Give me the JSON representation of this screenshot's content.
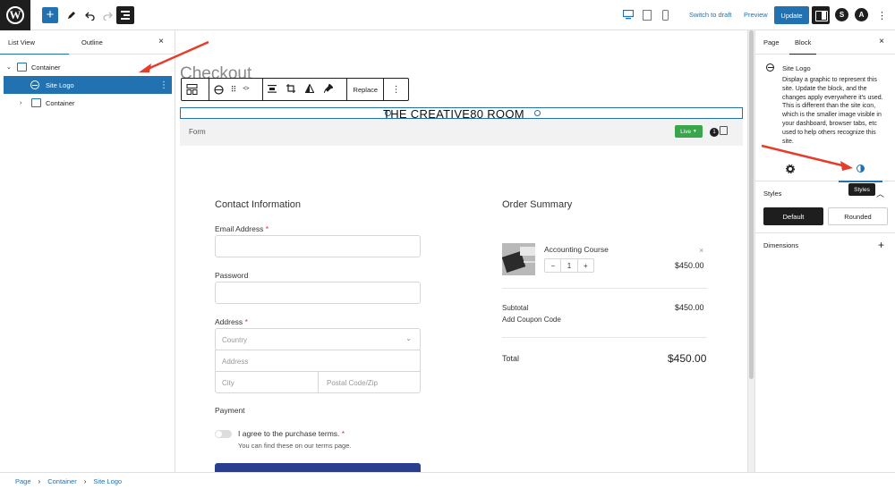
{
  "topbar": {
    "add_label": "+",
    "switch_to_draft": "Switch to draft",
    "preview": "Preview",
    "update": "Update",
    "plugin_a": "S",
    "plugin_b": "A"
  },
  "list_view": {
    "tabs": [
      "List View",
      "Outline"
    ],
    "close": "×",
    "items": [
      {
        "label": "Container"
      },
      {
        "label": "Site Logo"
      },
      {
        "label": "Container"
      }
    ],
    "more": "⋮"
  },
  "canvas": {
    "page_title": "Checkout",
    "toolbar_replace": "Replace",
    "site_logo_text": "THE CREATIVE80 ROOM",
    "form_label": "Form",
    "live_badge": "Live",
    "cart_count": "1",
    "contact": {
      "title": "Contact Information",
      "email_label": "Email Address",
      "password_label": "Password",
      "address_label": "Address",
      "required_mark": "*",
      "country_placeholder": "Country",
      "address_placeholder": "Address",
      "city_placeholder": "City",
      "postal_placeholder": "Postal Code/Zip",
      "payment_label": "Payment",
      "terms_label": "I agree to the purchase terms.",
      "terms_note": "You can find these on our terms page."
    },
    "order": {
      "title": "Order Summary",
      "item_name": "Accounting Course",
      "item_price": "$450.00",
      "qty_minus": "−",
      "qty_value": "1",
      "qty_plus": "+",
      "remove": "×",
      "subtotal_label": "Subtotal",
      "subtotal_value": "$450.00",
      "coupon_label": "Add Coupon Code",
      "total_label": "Total",
      "total_value": "$450.00"
    }
  },
  "settings": {
    "tabs": [
      "Page",
      "Block"
    ],
    "close": "×",
    "block_title": "Site Logo",
    "block_description": "Display a graphic to represent this site. Update the block, and the changes apply everywhere it's used. This is different than the site icon, which is the smaller image visible in your dashboard, browser tabs, etc used to help others recognize this site.",
    "tooltip": "Styles",
    "styles_title": "Styles",
    "style_options": [
      "Default",
      "Rounded"
    ],
    "dimensions_title": "Dimensions"
  },
  "breadcrumb": [
    "Page",
    "Container",
    "Site Logo"
  ],
  "colors": {
    "accent": "#2271b1",
    "dark": "#1e1e1e",
    "live": "#3aa64b",
    "annotation": "#e53d2a",
    "submit": "#2a3d8f"
  }
}
